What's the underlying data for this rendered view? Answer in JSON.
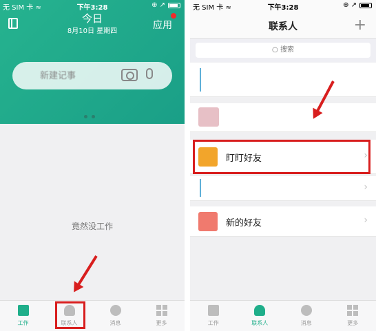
{
  "left": {
    "status": {
      "carrier": "无 SIM 卡 ≈",
      "time": "下午3:28",
      "icons": "⊕ ↗"
    },
    "header": {
      "title": "今日",
      "date": "8月10日 星期四",
      "apps_label": "应用"
    },
    "search": {
      "placeholder": "新建记事"
    },
    "empty_text": "竟然没工作",
    "tabs": [
      {
        "label": "工作"
      },
      {
        "label": "联系人"
      },
      {
        "label": "消息"
      },
      {
        "label": "更多"
      }
    ]
  },
  "right": {
    "status": {
      "carrier": "无 SIM 卡 ≈",
      "time": "下午3:28",
      "icons": "⊕ ↗"
    },
    "nav": {
      "title": "联系人",
      "plus": "+"
    },
    "search": {
      "placeholder": "○ 搜索"
    },
    "rows": [
      {
        "name": ""
      },
      {
        "name": ""
      },
      {
        "name": "盯盯好友"
      },
      {
        "name": ""
      },
      {
        "name": "新的好友"
      }
    ],
    "chevron": "›",
    "tabs": [
      {
        "label": "工作"
      },
      {
        "label": "联系人"
      },
      {
        "label": "消息"
      },
      {
        "label": "更多"
      }
    ]
  },
  "colors": {
    "brand_green": "#1fae8a",
    "highlight_red": "#d81e1e",
    "friends_orange": "#f2a52b",
    "new_friend_coral": "#f07a6e"
  },
  "icons": [
    "book-icon",
    "camera-icon",
    "mic-icon",
    "plus-icon",
    "search-icon",
    "person-icon",
    "message-icon",
    "grid-icon"
  ]
}
